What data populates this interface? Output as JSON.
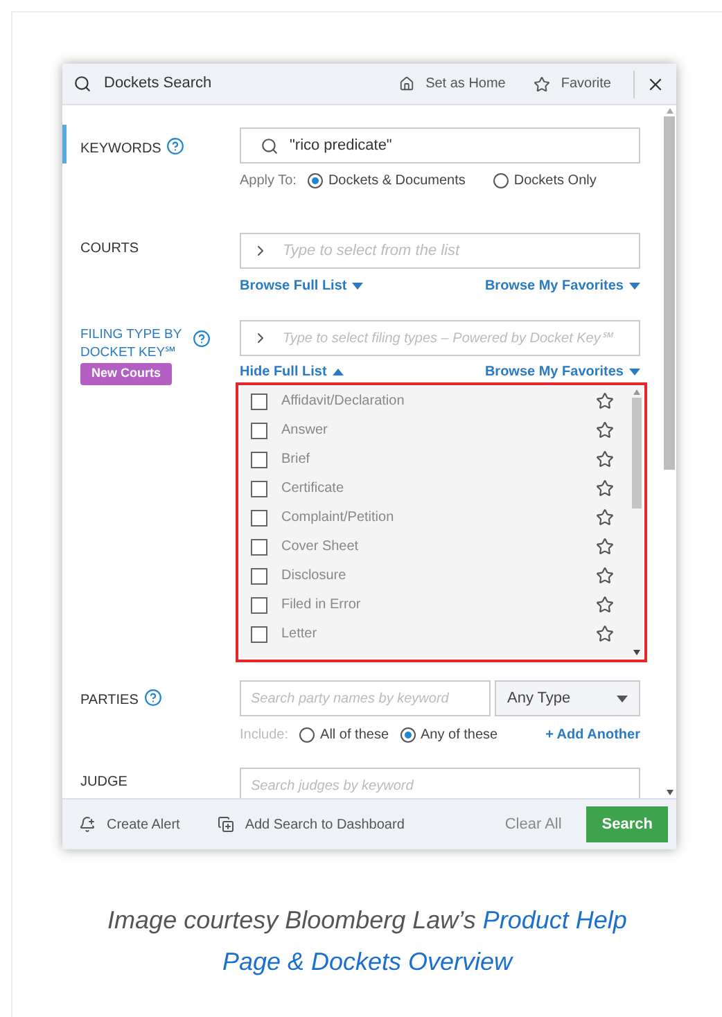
{
  "window": {
    "title": "Dockets Search",
    "actions": [
      "Set as Home",
      "Favorite"
    ]
  },
  "keywords": {
    "label": "KEYWORDS",
    "active": true,
    "value": "\"rico predicate\"",
    "apply_label": "Apply To:",
    "options": [
      {
        "label": "Dockets & Documents",
        "selected": true
      },
      {
        "label": "Dockets Only",
        "selected": false
      }
    ]
  },
  "courts": {
    "label": "COURTS",
    "placeholder": "Type to select from the list",
    "links": [
      "Browse Full List",
      "Browse My Favorites"
    ]
  },
  "filing_type": {
    "label_lines": [
      "FILING TYPE BY",
      "DOCKET KEY℠"
    ],
    "badge": "New Courts",
    "placeholder": "Type to select filing types – Powered by Docket Key℠",
    "links": [
      "Hide Full List",
      "Browse My Favorites"
    ],
    "items": [
      {
        "label": "Affidavit/Declaration",
        "checked": false
      },
      {
        "label": "Answer",
        "checked": false
      },
      {
        "label": "Brief",
        "checked": false
      },
      {
        "label": "Certificate",
        "checked": false
      },
      {
        "label": "Complaint/Petition",
        "checked": false
      },
      {
        "label": "Cover Sheet",
        "checked": false
      },
      {
        "label": "Disclosure",
        "checked": false
      },
      {
        "label": "Filed in Error",
        "checked": false
      },
      {
        "label": "Letter",
        "checked": false
      }
    ]
  },
  "parties": {
    "label": "PARTIES",
    "placeholder": "Search party names by keyword",
    "type_select": "Any Type",
    "include_label": "Include:",
    "options": [
      {
        "label": "All of these",
        "selected": false
      },
      {
        "label": "Any of these",
        "selected": true
      }
    ],
    "add_link": "+ Add Another"
  },
  "judge": {
    "label": "JUDGE",
    "placeholder": "Search judges by keyword"
  },
  "footer": {
    "create_alert": "Create Alert",
    "add_to_dashboard": "Add Search to Dashboard",
    "clear": "Clear All",
    "search": "Search"
  },
  "caption": {
    "text": "Image courtesy Bloomberg Law’s",
    "link_lines": [
      "Product Help",
      "Page & Dockets Overview"
    ]
  }
}
